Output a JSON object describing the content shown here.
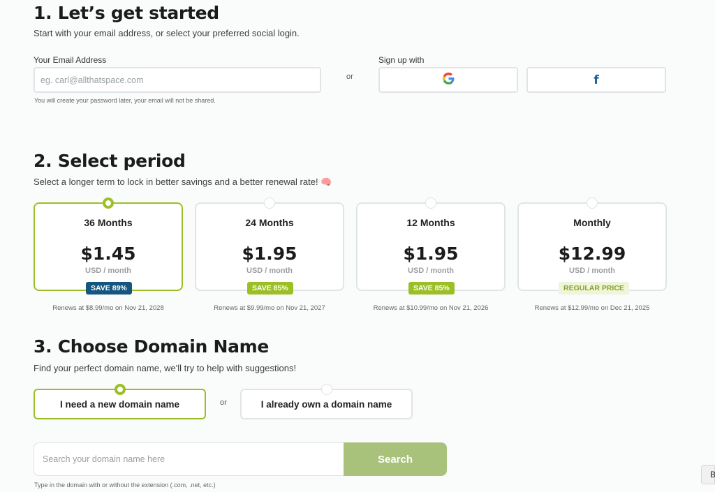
{
  "step1": {
    "title": "1. Let’s get started",
    "subtitle": "Start with your email address, or select your preferred social login.",
    "email_label": "Your Email Address",
    "email_placeholder": "eg. carl@allthatspace.com",
    "email_note": "You will create your password later, your email will not be shared.",
    "or": "or",
    "signup_label": "Sign up with",
    "social": [
      {
        "icon": "google-icon"
      },
      {
        "icon": "facebook-icon",
        "glyph": "f",
        "color": "#1f5e99"
      }
    ]
  },
  "step2": {
    "title": "2. Select period",
    "subtitle": "Select a longer term to lock in better savings and a better renewal rate! 🧠",
    "plans": [
      {
        "name": "36 Months",
        "price": "$1.45",
        "per": "USD / month",
        "badge": "SAVE 89%",
        "badge_style": "blue",
        "renew": "Renews at $8.99/mo on Nov 21, 2028",
        "selected": true
      },
      {
        "name": "24 Months",
        "price": "$1.95",
        "per": "USD / month",
        "badge": "SAVE 85%",
        "badge_style": "green",
        "renew": "Renews at $9.99/mo on Nov 21, 2027",
        "selected": false
      },
      {
        "name": "12 Months",
        "price": "$1.95",
        "per": "USD / month",
        "badge": "SAVE 85%",
        "badge_style": "green",
        "renew": "Renews at $10.99/mo on Nov 21, 2026",
        "selected": false
      },
      {
        "name": "Monthly",
        "price": "$12.99",
        "per": "USD / month",
        "badge": "REGULAR PRICE",
        "badge_style": "reg",
        "renew": "Renews at $12.99/mo on Dec 21, 2025",
        "selected": false
      }
    ]
  },
  "step3": {
    "title": "3. Choose Domain Name",
    "subtitle": "Find your perfect domain name, we'll try to help with suggestions!",
    "option_new": "I need a new domain name",
    "option_own": "I already own a domain name",
    "or": "or",
    "search_placeholder": "Search your domain name here",
    "search_button": "Search",
    "search_note": "Type in the domain with or without the extension (.com, .net, etc.)"
  },
  "floating": {
    "label": "B"
  },
  "colors": {
    "accent": "#9cbf26",
    "navy": "#14567d",
    "search_btn": "#a8c27c"
  }
}
